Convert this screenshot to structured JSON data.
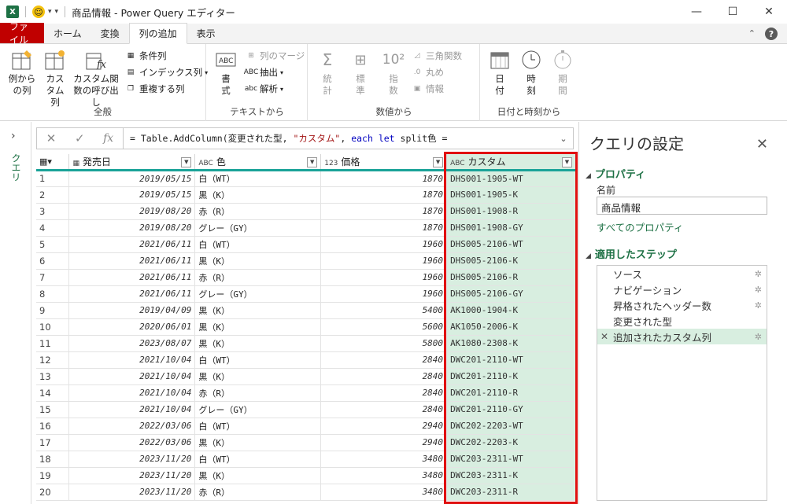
{
  "window": {
    "title": "商品情報 - Power Query エディター",
    "app_icon": "X",
    "quick_access": [
      "smiley-icon",
      "dropdown-icon"
    ],
    "controls": [
      "—",
      "☐",
      "✕"
    ]
  },
  "tabs": [
    {
      "label": "ファイル",
      "kind": "file"
    },
    {
      "label": "ホーム",
      "kind": "normal"
    },
    {
      "label": "変換",
      "kind": "normal"
    },
    {
      "label": "列の追加",
      "kind": "active"
    },
    {
      "label": "表示",
      "kind": "normal"
    }
  ],
  "ribbon": {
    "groups": {
      "general": "全般",
      "text": "テキストから",
      "number": "数値から",
      "datetime": "日付と時刻から"
    },
    "example_cols": "例からの列",
    "custom_col": "カスタム列",
    "invoke_fn": "カスタム関数の呼び出し",
    "conditional": "条件列",
    "index": "インデックス列",
    "duplicate": "重複する列",
    "format": "書式",
    "merge": "列のマージ",
    "extract": "抽出",
    "parse": "解析",
    "stats": "統計",
    "standard": "標準",
    "scientific": "指数",
    "trig": "三角関数",
    "round": "丸め",
    "info": "情報",
    "date": "日付",
    "time": "時刻",
    "duration": "期間"
  },
  "formula": {
    "prefix": "= Table.AddColumn(変更された型, ",
    "str": "\"カスタム\"",
    "mid": ", ",
    "kw": "each let",
    "suffix": " split色 ="
  },
  "left_rail": {
    "label": "クエリ"
  },
  "grid": {
    "headers": {
      "date": "発売日",
      "color": "色",
      "price": "価格",
      "custom": "カスタム",
      "type_text": "ABC",
      "type_num": "123"
    },
    "rows": [
      {
        "n": "1",
        "date": "2019/05/15",
        "color": "白（WT）",
        "price": "1870",
        "custom": "DHS001-1905-WT"
      },
      {
        "n": "2",
        "date": "2019/05/15",
        "color": "黒（K）",
        "price": "1870",
        "custom": "DHS001-1905-K"
      },
      {
        "n": "3",
        "date": "2019/08/20",
        "color": "赤（R）",
        "price": "1870",
        "custom": "DHS001-1908-R"
      },
      {
        "n": "4",
        "date": "2019/08/20",
        "color": "グレー（GY）",
        "price": "1870",
        "custom": "DHS001-1908-GY"
      },
      {
        "n": "5",
        "date": "2021/06/11",
        "color": "白（WT）",
        "price": "1960",
        "custom": "DHS005-2106-WT"
      },
      {
        "n": "6",
        "date": "2021/06/11",
        "color": "黒（K）",
        "price": "1960",
        "custom": "DHS005-2106-K"
      },
      {
        "n": "7",
        "date": "2021/06/11",
        "color": "赤（R）",
        "price": "1960",
        "custom": "DHS005-2106-R"
      },
      {
        "n": "8",
        "date": "2021/06/11",
        "color": "グレー（GY）",
        "price": "1960",
        "custom": "DHS005-2106-GY"
      },
      {
        "n": "9",
        "date": "2019/04/09",
        "color": "黒（K）",
        "price": "5400",
        "custom": "AK1000-1904-K"
      },
      {
        "n": "10",
        "date": "2020/06/01",
        "color": "黒（K）",
        "price": "5600",
        "custom": "AK1050-2006-K"
      },
      {
        "n": "11",
        "date": "2023/08/07",
        "color": "黒（K）",
        "price": "5800",
        "custom": "AK1080-2308-K"
      },
      {
        "n": "12",
        "date": "2021/10/04",
        "color": "白（WT）",
        "price": "2840",
        "custom": "DWC201-2110-WT"
      },
      {
        "n": "13",
        "date": "2021/10/04",
        "color": "黒（K）",
        "price": "2840",
        "custom": "DWC201-2110-K"
      },
      {
        "n": "14",
        "date": "2021/10/04",
        "color": "赤（R）",
        "price": "2840",
        "custom": "DWC201-2110-R"
      },
      {
        "n": "15",
        "date": "2021/10/04",
        "color": "グレー（GY）",
        "price": "2840",
        "custom": "DWC201-2110-GY"
      },
      {
        "n": "16",
        "date": "2022/03/06",
        "color": "白（WT）",
        "price": "2940",
        "custom": "DWC202-2203-WT"
      },
      {
        "n": "17",
        "date": "2022/03/06",
        "color": "黒（K）",
        "price": "2940",
        "custom": "DWC202-2203-K"
      },
      {
        "n": "18",
        "date": "2023/11/20",
        "color": "白（WT）",
        "price": "3480",
        "custom": "DWC203-2311-WT"
      },
      {
        "n": "19",
        "date": "2023/11/20",
        "color": "黒（K）",
        "price": "3480",
        "custom": "DWC203-2311-K"
      },
      {
        "n": "20",
        "date": "2023/11/20",
        "color": "赤（R）",
        "price": "3480",
        "custom": "DWC203-2311-R"
      }
    ]
  },
  "settings": {
    "title": "クエリの設定",
    "properties_h": "プロパティ",
    "name_label": "名前",
    "name_value": "商品情報",
    "all_props": "すべてのプロパティ",
    "steps_h": "適用したステップ",
    "steps": [
      {
        "label": "ソース",
        "gear": true,
        "active": false
      },
      {
        "label": "ナビゲーション",
        "gear": true,
        "active": false
      },
      {
        "label": "昇格されたヘッダー数",
        "gear": true,
        "active": false
      },
      {
        "label": "変更された型",
        "gear": false,
        "active": false
      },
      {
        "label": "追加されたカスタム列",
        "gear": true,
        "active": true
      }
    ]
  },
  "colors": {
    "accent_green": "#1e7145",
    "file_tab": "#c00000",
    "highlight": "#d8eee0",
    "header_rule": "#1aa398",
    "red_box": "#e01010"
  }
}
